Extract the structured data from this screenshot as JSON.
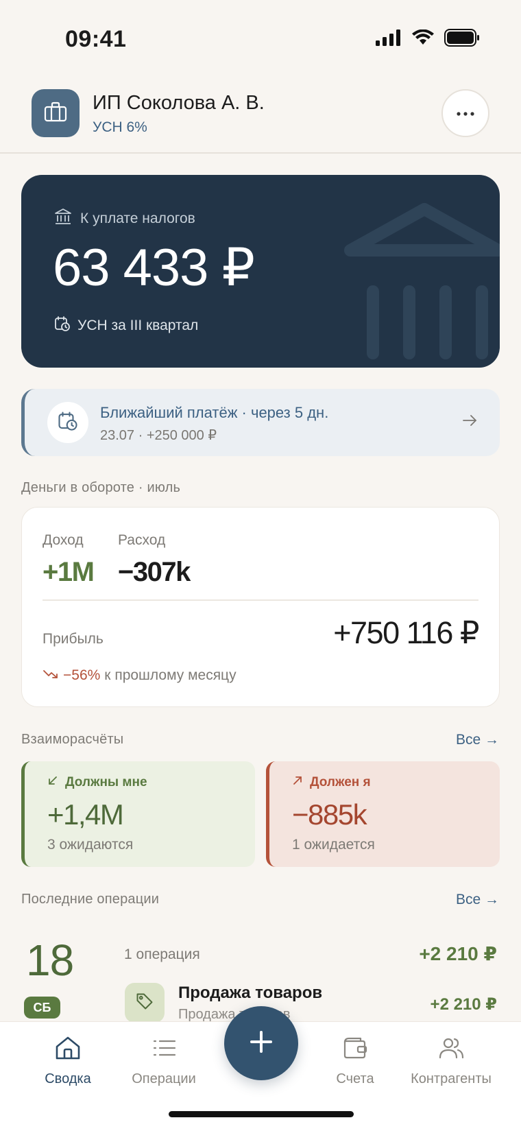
{
  "status_bar": {
    "time": "09:41"
  },
  "header": {
    "company_name": "ИП Соколова А. В.",
    "tax_regime": "УСН 6%",
    "icons": {
      "avatar": "briefcase-icon",
      "more": "more-dots-icon"
    }
  },
  "tax_card": {
    "label": "К уплате налогов",
    "amount": "63 433 ₽",
    "period": "УСН за III квартал",
    "icons": {
      "label": "bank-icon",
      "period": "calendar-clock-icon",
      "watermark": "bank-icon"
    }
  },
  "next_payment": {
    "title": "Ближайший платёж · через 5 дн.",
    "subtitle": "23.07 · +250 000 ₽",
    "icons": {
      "main": "calendar-clock-icon",
      "arrow": "arrow-right-icon"
    }
  },
  "money_section": {
    "title": "Деньги в обороте · июль",
    "income_label": "Доход",
    "income_value": "+1M",
    "expense_label": "Расход",
    "expense_value": "−307k",
    "profit_label": "Прибыль",
    "profit_value": "+750 116 ₽",
    "change_value": "−56%",
    "change_text": "к прошлому месяцу"
  },
  "settlements": {
    "title": "Взаиморасчёты",
    "all_link": "Все →",
    "owed_to_me": {
      "label": "Должны мне",
      "value": "+1,4M",
      "sub": "3 ожидаются"
    },
    "i_owe": {
      "label": "Должен я",
      "value": "−885k",
      "sub": "1 ожидается"
    }
  },
  "operations": {
    "title": "Последние операции",
    "all_link": "Все →",
    "day_number": "18",
    "day_badge": "СБ",
    "count": "1 операция",
    "day_total": "+2 210 ₽",
    "item": {
      "title": "Продажа товаров",
      "subtitle": "Продажа товаров",
      "amount": "+2 210 ₽",
      "icon": "tag-icon"
    }
  },
  "bottom_nav": {
    "items": [
      {
        "label": "Сводка",
        "icon": "home-icon",
        "active": true
      },
      {
        "label": "Операции",
        "icon": "list-icon",
        "active": false
      },
      {
        "label": "Счета",
        "icon": "wallet-icon",
        "active": false
      },
      {
        "label": "Контрагенты",
        "icon": "users-icon",
        "active": false
      }
    ],
    "fab_icon": "plus-icon"
  },
  "colors": {
    "background": "#f8f5f1",
    "primary": "#223447",
    "accent_blue": "#3d6183",
    "positive": "#5a7a40",
    "negative": "#b4523a"
  }
}
